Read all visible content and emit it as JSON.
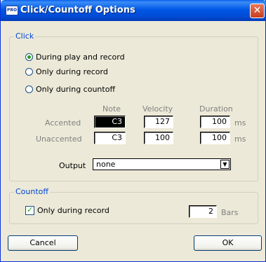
{
  "window": {
    "title": "Click/Countoff Options",
    "icon_text": "PRO"
  },
  "click_group": {
    "legend": "Click",
    "options": [
      {
        "label": "During play and record",
        "checked": true
      },
      {
        "label": "Only during record",
        "checked": false
      },
      {
        "label": "Only during countoff",
        "checked": false
      }
    ],
    "columns": {
      "note": "Note",
      "velocity": "Velocity",
      "duration": "Duration"
    },
    "rows": {
      "accented": {
        "label": "Accented",
        "note": "C3",
        "velocity": "127",
        "duration": "100",
        "unit": "ms"
      },
      "unaccented": {
        "label": "Unaccented",
        "note": "C3",
        "velocity": "100",
        "duration": "100",
        "unit": "ms"
      }
    },
    "output": {
      "label": "Output",
      "value": "none"
    }
  },
  "countoff_group": {
    "legend": "Countoff",
    "only_during_record": {
      "label": "Only during record",
      "checked": true
    },
    "bars": {
      "value": "2",
      "unit": "Bars"
    }
  },
  "buttons": {
    "cancel": "Cancel",
    "ok": "OK"
  }
}
